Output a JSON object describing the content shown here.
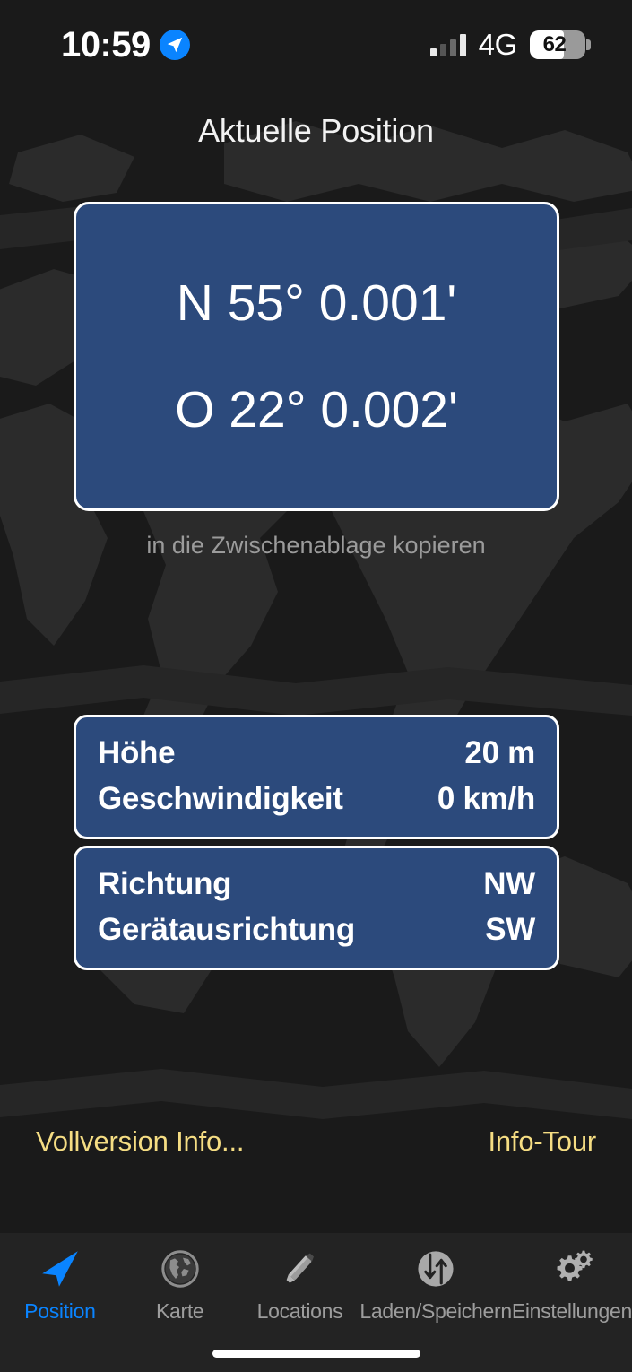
{
  "status_bar": {
    "clock": "10:59",
    "location_icon": "navigation-arrow-icon",
    "signal_icon": "cellular-signal-icon",
    "network": "4G",
    "battery_level": "62",
    "battery_percent": 62
  },
  "header": {
    "title": "Aktuelle Position"
  },
  "coordinates": {
    "latitude": "N 55° 0.001'",
    "longitude": "O 22° 0.002'",
    "copy_hint": "in die Zwischenablage kopieren",
    "card_color": "#2c4a7c",
    "border_color": "#ffffff"
  },
  "info_cards": [
    {
      "rows": [
        {
          "label": "Höhe",
          "value": "20 m"
        },
        {
          "label": "Geschwindigkeit",
          "value": "0 km/h"
        }
      ]
    },
    {
      "rows": [
        {
          "label": "Richtung",
          "value": "NW"
        },
        {
          "label": "Gerätausrichtung",
          "value": "SW"
        }
      ]
    }
  ],
  "links": {
    "full_version": "Vollversion Info...",
    "info_tour": "Info-Tour",
    "color": "#f5dd83"
  },
  "tab_bar": {
    "active_color": "#0a84ff",
    "inactive_color": "#9d9d9d",
    "items": [
      {
        "label": "Position",
        "icon": "navigation-arrow-icon",
        "active": true
      },
      {
        "label": "Karte",
        "icon": "globe-icon",
        "active": false
      },
      {
        "label": "Locations",
        "icon": "pencil-icon",
        "active": false
      },
      {
        "label": "Laden/Speichern",
        "icon": "load-save-arrows-icon",
        "active": false
      },
      {
        "label": "Einstellungen",
        "icon": "gears-icon",
        "active": false
      }
    ]
  }
}
